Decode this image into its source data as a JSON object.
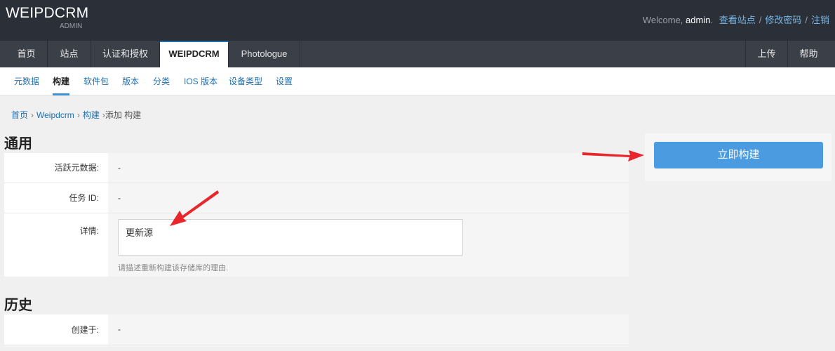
{
  "header": {
    "brand_title": "WEIPDCRM",
    "brand_sub": "ADMIN",
    "welcome_prefix": "Welcome, ",
    "username": "admin",
    "welcome_suffix": ".",
    "links": [
      "查看站点",
      "修改密码",
      "注销"
    ],
    "separator": "/"
  },
  "nav": {
    "items": [
      "首页",
      "站点",
      "认证和授权",
      "WEIPDCRM",
      "Photologue"
    ],
    "active_index": 3,
    "right_items": [
      "上传",
      "帮助"
    ]
  },
  "subnav": {
    "items": [
      "元数据",
      "构建",
      "软件包",
      "版本",
      "分类",
      "IOS 版本",
      "设备类型",
      "设置"
    ],
    "active_index": 1
  },
  "breadcrumb": {
    "items": [
      "首页",
      "Weipdcrm",
      "构建"
    ],
    "current": "添加 构建",
    "separator": "›"
  },
  "general": {
    "title": "通用",
    "active_release_label": "活跃元数据:",
    "active_release_value": "-",
    "job_id_label": "任务 ID:",
    "job_id_value": "-",
    "details_label": "详情:",
    "details_value": "更新源",
    "details_help": "请描述重新构建该存储库的理由."
  },
  "history": {
    "title": "历史",
    "created_label": "创建于:",
    "created_value": "-"
  },
  "actions": {
    "build_now_label": "立即构建"
  },
  "colors": {
    "header_bg": "#2b2f37",
    "nav_bg": "#3b3f47",
    "link": "#1f6fad",
    "primary_button": "#4a9be0",
    "arrow": "#e8262b"
  }
}
